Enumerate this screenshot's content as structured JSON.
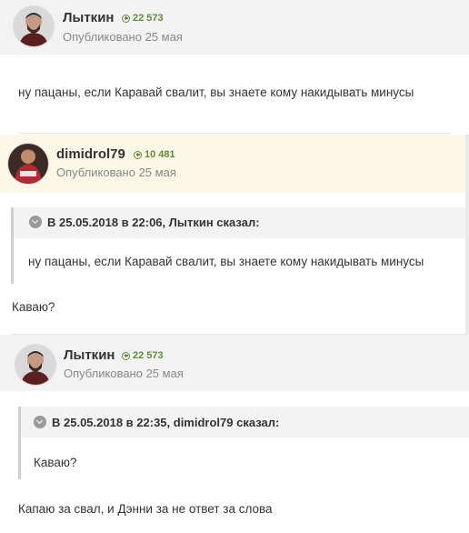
{
  "posts": [
    {
      "author": "Лыткин",
      "reputation": "22 573",
      "published": "Опубликовано 25 мая",
      "text": "ну пацаны, если Каравай свалит, вы знаете кому накидывать минусы"
    },
    {
      "author": "dimidrol79",
      "reputation": "10 481",
      "published": "Опубликовано 25 мая",
      "quote_cite": "В 25.05.2018 в 22:06, Лыткин сказал:",
      "quote_text": "ну пацаны, если Каравай свалит, вы знаете кому накидывать минусы",
      "text": "Каваю?"
    },
    {
      "author": "Лыткин",
      "reputation": "22 573",
      "published": "Опубликовано 25 мая",
      "quote_cite": "В 25.05.2018 в 22:35, dimidrol79 сказал:",
      "quote_text": "Каваю?",
      "text": "Капаю за свал, и Дэнни за не ответ за слова"
    }
  ]
}
